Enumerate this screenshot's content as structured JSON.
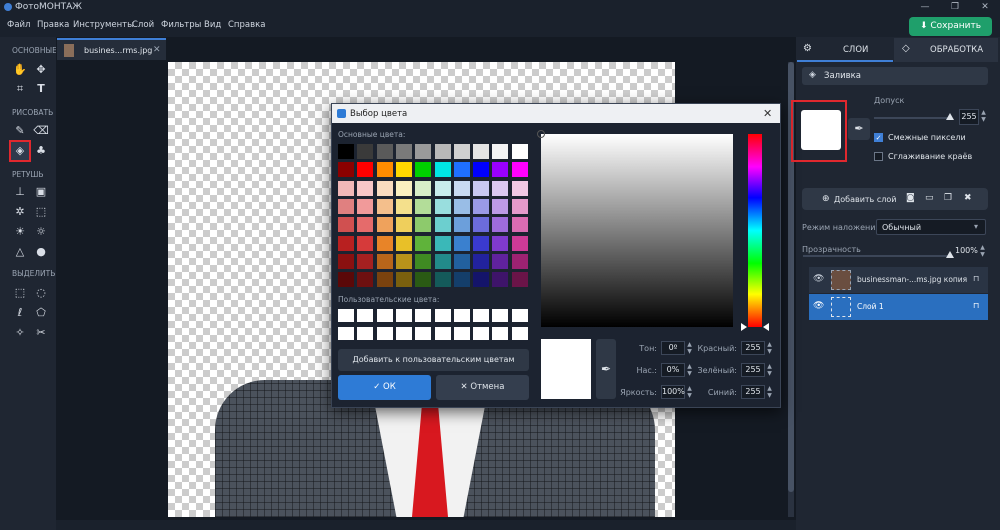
{
  "app": {
    "title": "ФотоМОНТАЖ",
    "min": "—",
    "max": "❐",
    "close": "✕"
  },
  "menu": [
    "Файл",
    "Правка",
    "Инструменты",
    "Слой",
    "Фильтры",
    "Вид",
    "Справка"
  ],
  "save_label": "Сохранить",
  "toolbar": {
    "sections": [
      "ОСНОВНЫЕ",
      "РИСОВАТЬ",
      "РЕТУШЬ",
      "ВЫДЕЛИТЬ"
    ],
    "selected_tool": "fill-tool"
  },
  "file_tab": {
    "name": "busines...rms.jpg",
    "close": "✕"
  },
  "panel": {
    "tabs": {
      "layers": "СЛОИ",
      "processing": "ОБРАБОТКА"
    },
    "fill_label": "Заливка",
    "tolerance_label": "Допуск",
    "tolerance_value": "255",
    "contiguous_label": "Смежные пиксели",
    "contiguous_checked": true,
    "antialias_label": "Сглаживание краёв",
    "antialias_checked": false,
    "add_layer_label": "Добавить слой",
    "blend_label": "Режим наложения:",
    "blend_value": "Обычный",
    "opacity_label": "Прозрачность",
    "opacity_value": "100%",
    "layers": [
      {
        "name": "businessman-...ms.jpg копия",
        "selected": false
      },
      {
        "name": "Слой 1",
        "selected": true
      }
    ]
  },
  "dialog": {
    "title": "Выбор цвета",
    "basic_label": "Основные цвета:",
    "custom_label": "Пользовательские цвета:",
    "add_custom_label": "Добавить к пользовательским цветам",
    "ok_label": "ОК",
    "cancel_label": "Отмена",
    "hue_label": "Тон:",
    "hue_value": "0º",
    "sat_label": "Нас.:",
    "sat_value": "0%",
    "val_label": "Яркость:",
    "val_value": "100%",
    "red_label": "Красный:",
    "red_value": "255",
    "green_label": "Зелёный:",
    "green_value": "255",
    "blue_label": "Синий:",
    "blue_value": "255",
    "basic_colors": [
      [
        "#000000",
        "#3a3a3a",
        "#5a5a5a",
        "#7a7a7a",
        "#9a9a9a",
        "#b8b8b8",
        "#d0d0d0",
        "#e4e4e4",
        "#f4f4f4",
        "#ffffff"
      ],
      [
        "#8b0000",
        "#ff0000",
        "#ff8c00",
        "#ffd800",
        "#00d000",
        "#00e5e5",
        "#1f6fff",
        "#0000ff",
        "#9b00ff",
        "#ff00ff"
      ],
      [
        "#f0b8b8",
        "#f7c7c7",
        "#f9dcc0",
        "#faf0c0",
        "#d8efc8",
        "#c8ecec",
        "#c8daf2",
        "#c8c8f2",
        "#dcc8f2",
        "#f2c8e4"
      ],
      [
        "#e08080",
        "#f19a9a",
        "#f4bf8c",
        "#f4e08c",
        "#b3dd99",
        "#99dede",
        "#99bde6",
        "#9a9ae6",
        "#bd9ae6",
        "#e69acb"
      ],
      [
        "#d05050",
        "#e56b6b",
        "#efa25c",
        "#efcf5c",
        "#8dca6c",
        "#6ccfcf",
        "#6c9fdb",
        "#6c6cdb",
        "#9f6cdb",
        "#db6cb2"
      ],
      [
        "#b82020",
        "#d63a3a",
        "#e88428",
        "#e8c028",
        "#5fb33a",
        "#3ab8b8",
        "#3a80cf",
        "#3a3acf",
        "#803acf",
        "#cf3a97"
      ],
      [
        "#8a1010",
        "#a52020",
        "#b8651a",
        "#b8931a",
        "#3f8a22",
        "#228a8a",
        "#22609e",
        "#22229e",
        "#60229e",
        "#9e2272"
      ],
      [
        "#5a0808",
        "#6e1010",
        "#7a420e",
        "#7a600e",
        "#2a5a14",
        "#145a5a",
        "#143e6a",
        "#14146a",
        "#3e146a",
        "#6a1448"
      ]
    ]
  }
}
